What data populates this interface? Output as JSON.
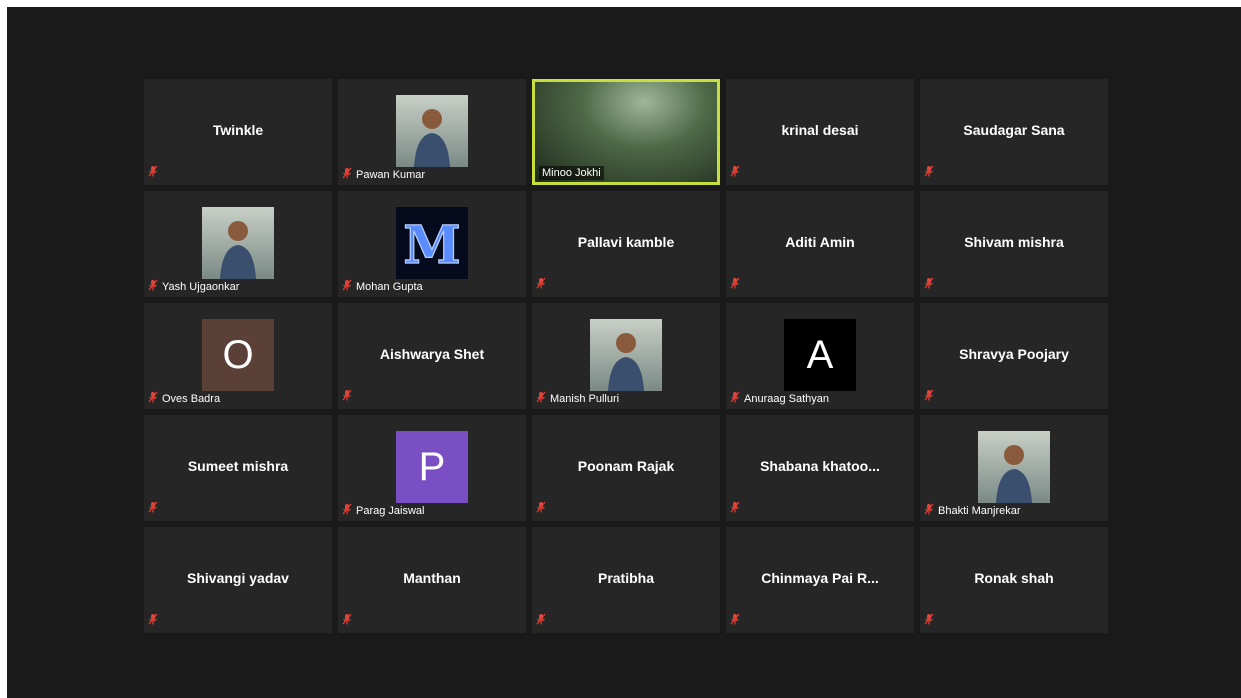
{
  "colors": {
    "background": "#1a1a1a",
    "tile": "#262626",
    "active_speaker_border": "#c6df3c",
    "mute_icon": "#e0433a"
  },
  "participants": [
    {
      "name": "Twinkle",
      "display": "name"
    },
    {
      "name": "Pawan Kumar",
      "display": "photo",
      "icon": "user-photo"
    },
    {
      "name": "Minoo Jokhi",
      "display": "video",
      "active": true
    },
    {
      "name": "krinal desai",
      "display": "name"
    },
    {
      "name": "Saudagar Sana",
      "display": "name"
    },
    {
      "name": "Yash Ujgaonkar",
      "display": "photo",
      "icon": "user-photo"
    },
    {
      "name": "Mohan Gupta",
      "display": "photo",
      "icon": "letter-m-image"
    },
    {
      "name": "Pallavi kamble",
      "display": "name"
    },
    {
      "name": "Aditi Amin",
      "display": "name"
    },
    {
      "name": "Shivam mishra",
      "display": "name"
    },
    {
      "name": "Oves Badra",
      "display": "letter",
      "letter": "O",
      "color": "#5b4037"
    },
    {
      "name": "Aishwarya Shet",
      "display": "name"
    },
    {
      "name": "Manish Pulluri",
      "display": "photo",
      "icon": "user-photo"
    },
    {
      "name": "Anuraag Sathyan",
      "display": "letter",
      "letter": "A",
      "color": "#000000"
    },
    {
      "name": "Shravya Poojary",
      "display": "name"
    },
    {
      "name": "Sumeet mishra",
      "display": "name"
    },
    {
      "name": "Parag Jaiswal",
      "display": "letter",
      "letter": "P",
      "color": "#7b4fc4"
    },
    {
      "name": "Poonam Rajak",
      "display": "name"
    },
    {
      "name": "Shabana  khatoo...",
      "display": "name"
    },
    {
      "name": "Bhakti Manjrekar",
      "display": "photo",
      "icon": "user-photo"
    },
    {
      "name": "Shivangi yadav",
      "display": "name"
    },
    {
      "name": "Manthan",
      "display": "name"
    },
    {
      "name": "Pratibha",
      "display": "name"
    },
    {
      "name": "Chinmaya Pai  R...",
      "display": "name"
    },
    {
      "name": "Ronak shah",
      "display": "name"
    }
  ]
}
